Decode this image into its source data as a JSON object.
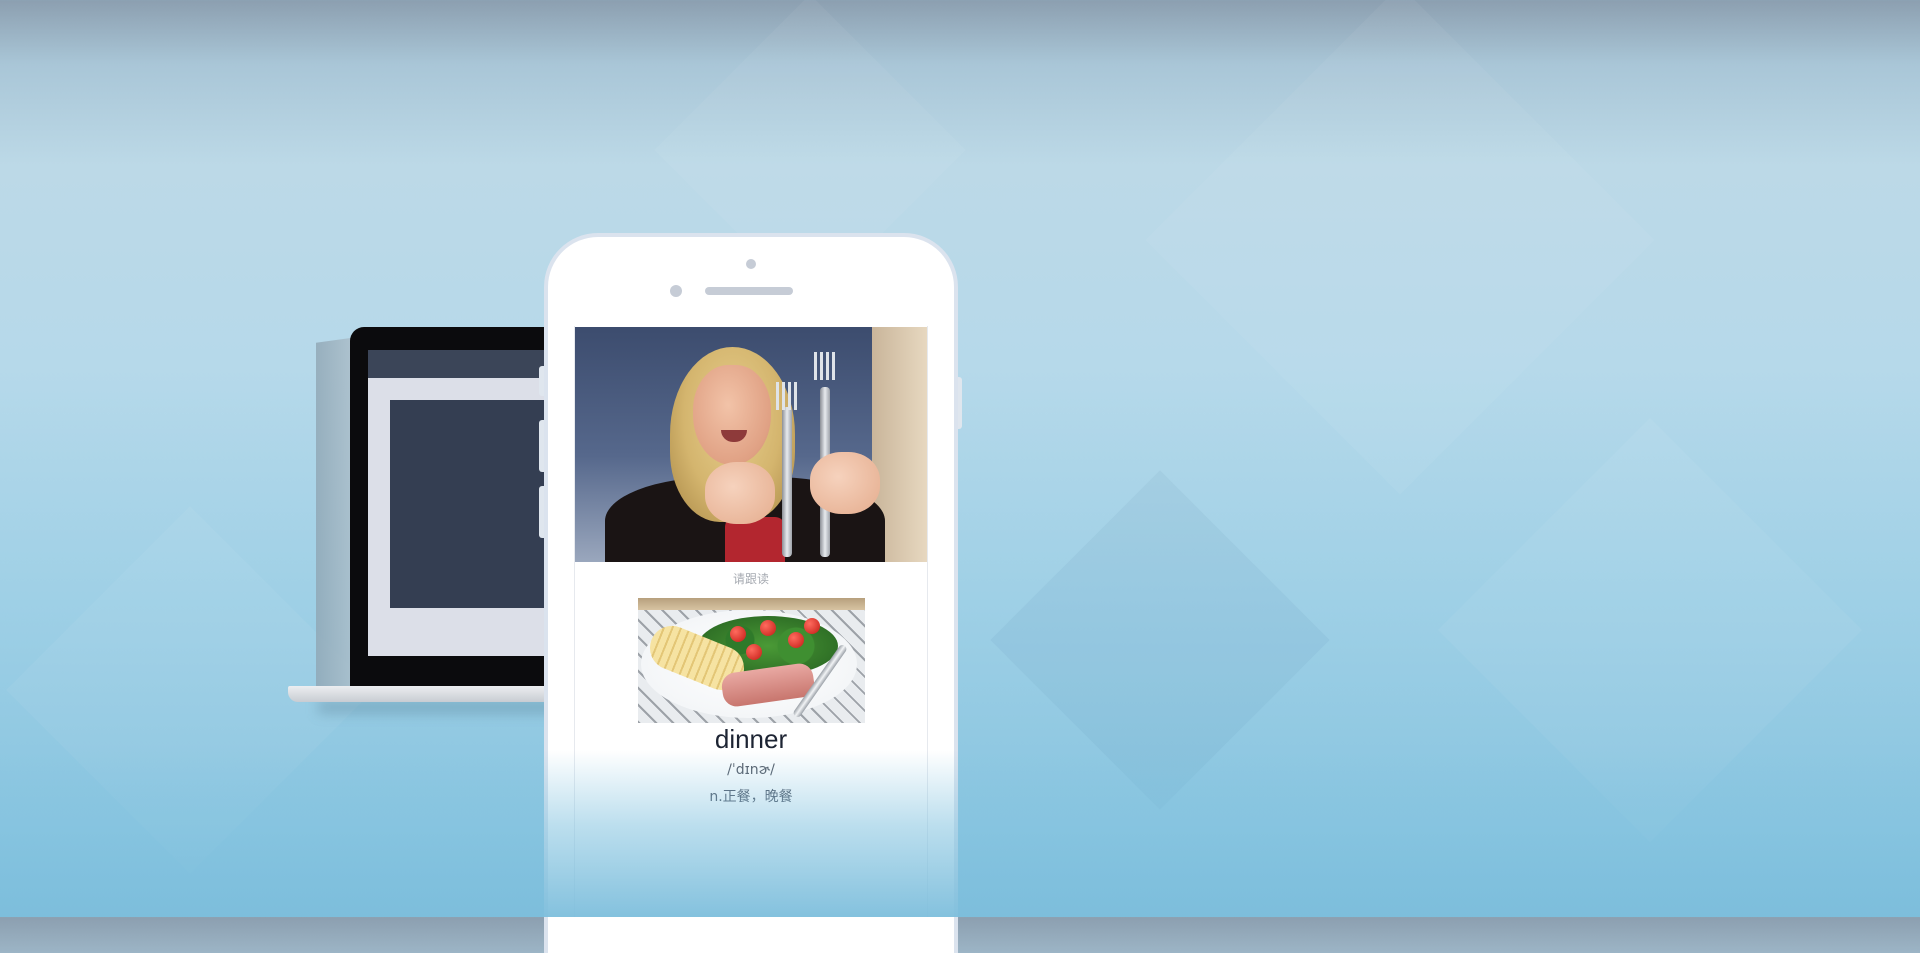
{
  "phone": {
    "prompt_text": "请跟读",
    "word": "dinner",
    "phonetic": "/ˈdɪnɚ/",
    "meaning": "n.正餐，晚餐"
  },
  "colors": {
    "background_top": "#8c9fb0",
    "background_bottom": "#80c0dd",
    "word_text": "#1d2433",
    "prompt_text": "#a6aab1"
  },
  "icons": {
    "camera": "front-camera-icon",
    "speaker": "earpiece-icon"
  }
}
